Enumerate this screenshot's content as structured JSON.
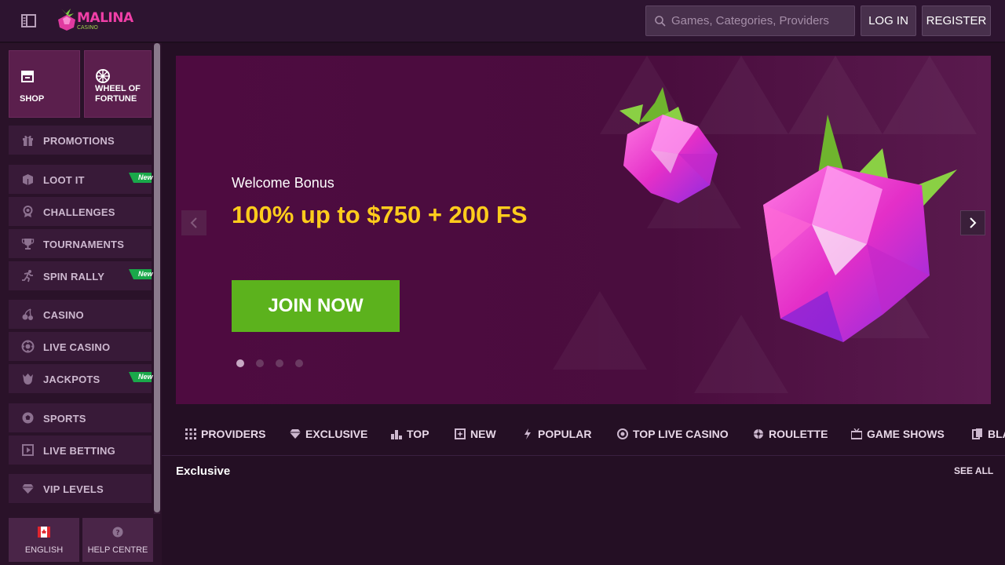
{
  "header": {
    "logo_text": "MALINA",
    "logo_sub": "CASINO",
    "search_placeholder": "Games, Categories, Providers",
    "login_label": "LOG IN",
    "register_label": "REGISTER"
  },
  "sidebar": {
    "tiles": [
      {
        "label": "SHOP",
        "icon": "shop-icon"
      },
      {
        "label": "WHEEL OF FORTUNE",
        "icon": "wheel-icon"
      }
    ],
    "items": [
      {
        "label": "PROMOTIONS",
        "icon": "gift-icon",
        "new": false
      },
      {
        "label": "LOOT IT",
        "icon": "box-icon",
        "new": true
      },
      {
        "label": "CHALLENGES",
        "icon": "badge-icon",
        "new": false
      },
      {
        "label": "TOURNAMENTS",
        "icon": "trophy-icon",
        "new": false
      },
      {
        "label": "SPIN RALLY",
        "icon": "runner-icon",
        "new": true
      },
      {
        "label": "CASINO",
        "icon": "cherry-icon",
        "new": false
      },
      {
        "label": "LIVE CASINO",
        "icon": "chip-icon",
        "new": false
      },
      {
        "label": "JACKPOTS",
        "icon": "pot-icon",
        "new": true
      },
      {
        "label": "SPORTS",
        "icon": "ball-icon",
        "new": false
      },
      {
        "label": "LIVE BETTING",
        "icon": "live-icon",
        "new": false
      },
      {
        "label": "VIP LEVELS",
        "icon": "diamond-icon",
        "new": false
      }
    ],
    "new_badge": "New",
    "bottom": [
      {
        "label": "ENGLISH",
        "icon": "canada-flag-icon"
      },
      {
        "label": "HELP CENTRE",
        "icon": "help-icon"
      }
    ]
  },
  "banner": {
    "welcome": "Welcome Bonus",
    "headline": "100% up to $750 + 200 FS",
    "cta": "JOIN NOW",
    "slide_count": 4,
    "active_slide": 1
  },
  "categories": [
    {
      "label": "PROVIDERS",
      "icon": "grid-icon"
    },
    {
      "label": "EXCLUSIVE",
      "icon": "diamond-icon"
    },
    {
      "label": "TOP",
      "icon": "podium-icon"
    },
    {
      "label": "NEW",
      "icon": "new-box-icon"
    },
    {
      "label": "POPULAR",
      "icon": "lightning-icon"
    },
    {
      "label": "TOP LIVE CASINO",
      "icon": "live-chip-icon"
    },
    {
      "label": "ROULETTE",
      "icon": "roulette-icon"
    },
    {
      "label": "GAME SHOWS",
      "icon": "tv-icon"
    },
    {
      "label": "BLA",
      "icon": "cards-icon"
    }
  ],
  "section": {
    "title": "Exclusive",
    "see_all": "SEE ALL"
  },
  "colors": {
    "headline": "#ffcc1c",
    "cta": "#5cb21d",
    "new_badge": "#1aa84a",
    "brand_pink": "#f03fa7"
  }
}
